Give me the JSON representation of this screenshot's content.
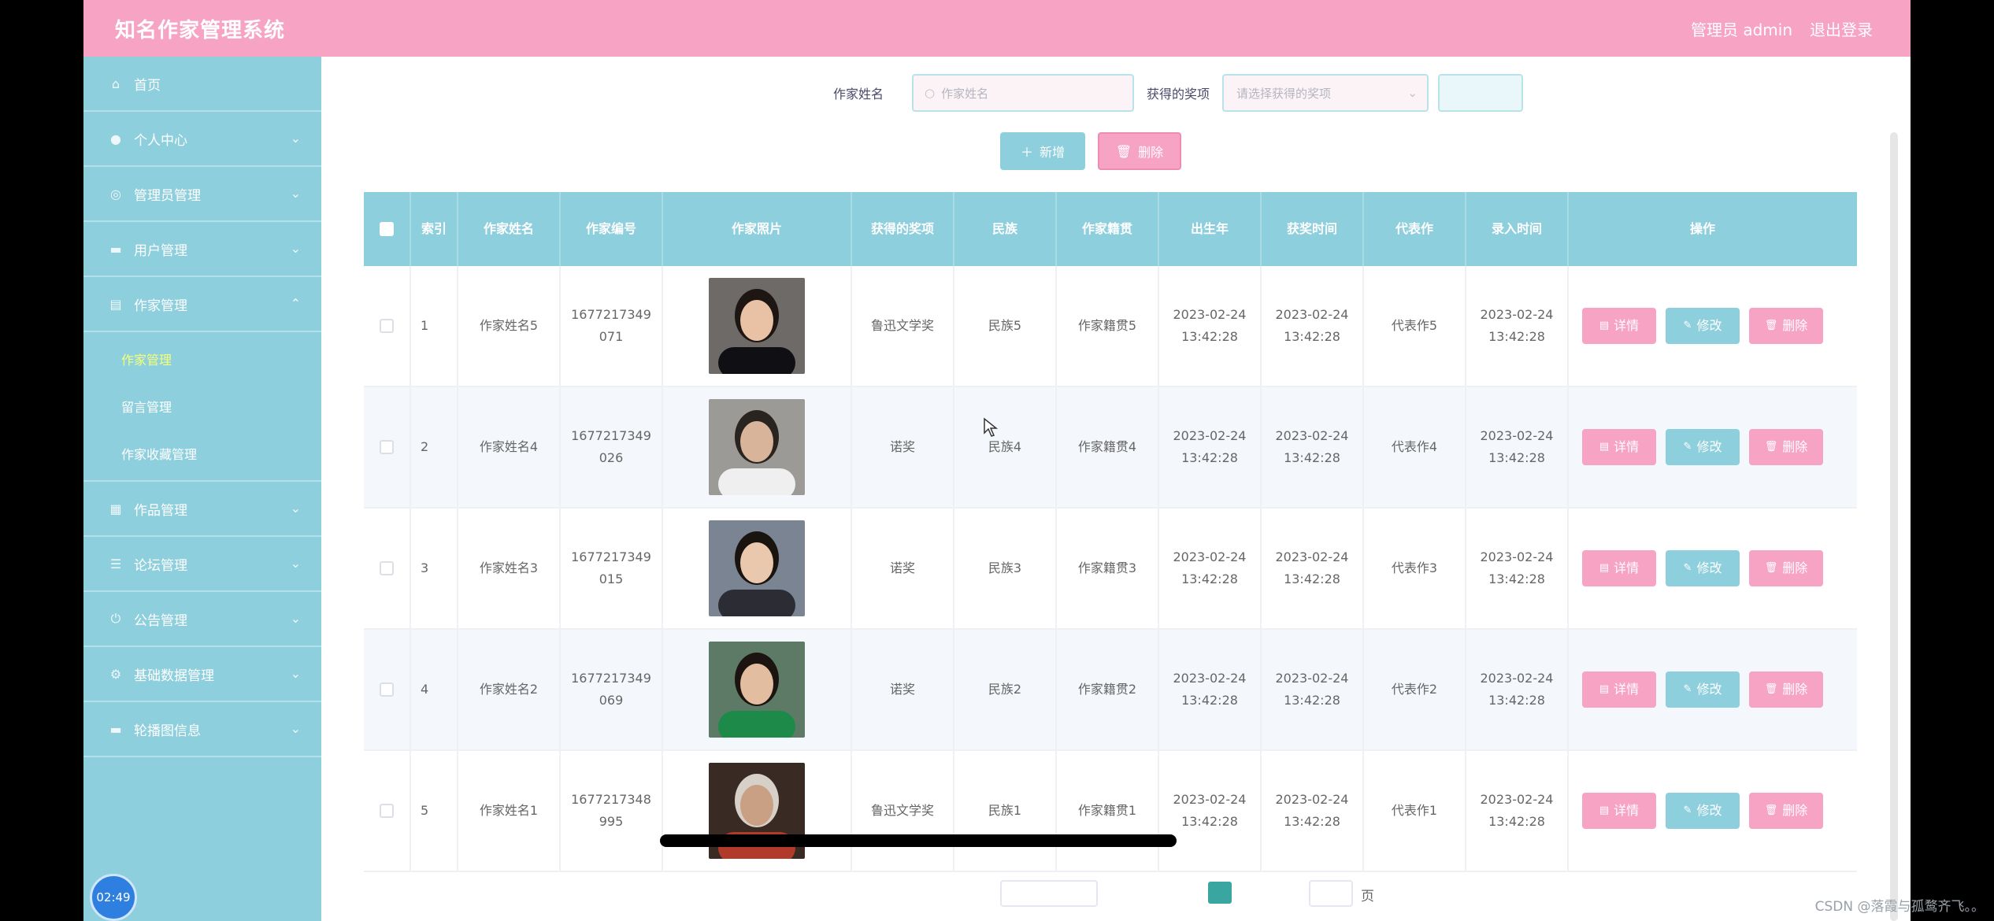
{
  "header": {
    "title": "知名作家管理系统",
    "user": "管理员 admin",
    "logout": "退出登录"
  },
  "sidebar": {
    "items": [
      {
        "label": "首页",
        "icon": "home-icon",
        "glyph": "⌂",
        "chevron": ""
      },
      {
        "label": "个人中心",
        "icon": "person-icon",
        "glyph": "●",
        "chevron": "⌄"
      },
      {
        "label": "管理员管理",
        "icon": "globe-icon",
        "glyph": "◎",
        "chevron": "⌄"
      },
      {
        "label": "用户管理",
        "icon": "ticket-icon",
        "glyph": "▬",
        "chevron": "⌄"
      },
      {
        "label": "作家管理",
        "icon": "folder-icon",
        "glyph": "▤",
        "chevron": "⌃"
      }
    ],
    "subitems": [
      {
        "label": "作家管理",
        "active": true
      },
      {
        "label": "留言管理",
        "active": false
      },
      {
        "label": "作家收藏管理",
        "active": false
      }
    ],
    "items_after": [
      {
        "label": "作品管理",
        "icon": "grid-icon",
        "glyph": "▦",
        "chevron": "⌄"
      },
      {
        "label": "论坛管理",
        "icon": "list-icon",
        "glyph": "☰",
        "chevron": "⌄"
      },
      {
        "label": "公告管理",
        "icon": "power-icon",
        "glyph": "⏻",
        "chevron": "⌄"
      },
      {
        "label": "基础数据管理",
        "icon": "gear-icon",
        "glyph": "⚙",
        "chevron": "⌄"
      },
      {
        "label": "轮播图信息",
        "icon": "image-icon",
        "glyph": "▬",
        "chevron": "⌄"
      }
    ],
    "clock": "02:49"
  },
  "search": {
    "name_label": "作家姓名",
    "name_placeholder": "作家姓名",
    "award_label": "获得的奖项",
    "award_placeholder": "请选择获得的奖项"
  },
  "actions": {
    "add": "新增",
    "delete": "删除"
  },
  "table": {
    "headers": [
      "索引",
      "作家姓名",
      "作家编号",
      "作家照片",
      "获得的奖项",
      "民族",
      "作家籍贯",
      "出生年",
      "获奖时间",
      "代表作",
      "录入时间",
      "操作"
    ],
    "rows": [
      {
        "index": "1",
        "name": "作家姓名5",
        "code1": "1677217349",
        "code2": "071",
        "award": "鲁迅文学奖",
        "ethnic": "民族5",
        "origin": "作家籍贯5",
        "birth_d": "2023-02-24",
        "birth_t": "13:42:28",
        "award_d": "2023-02-24",
        "award_t": "13:42:28",
        "work": "代表作5",
        "entry_d": "2023-02-24",
        "entry_t": "13:42:28"
      },
      {
        "index": "2",
        "name": "作家姓名4",
        "code1": "1677217349",
        "code2": "026",
        "award": "诺奖",
        "ethnic": "民族4",
        "origin": "作家籍贯4",
        "birth_d": "2023-02-24",
        "birth_t": "13:42:28",
        "award_d": "2023-02-24",
        "award_t": "13:42:28",
        "work": "代表作4",
        "entry_d": "2023-02-24",
        "entry_t": "13:42:28"
      },
      {
        "index": "3",
        "name": "作家姓名3",
        "code1": "1677217349",
        "code2": "015",
        "award": "诺奖",
        "ethnic": "民族3",
        "origin": "作家籍贯3",
        "birth_d": "2023-02-24",
        "birth_t": "13:42:28",
        "award_d": "2023-02-24",
        "award_t": "13:42:28",
        "work": "代表作3",
        "entry_d": "2023-02-24",
        "entry_t": "13:42:28"
      },
      {
        "index": "4",
        "name": "作家姓名2",
        "code1": "1677217349",
        "code2": "069",
        "award": "诺奖",
        "ethnic": "民族2",
        "origin": "作家籍贯2",
        "birth_d": "2023-02-24",
        "birth_t": "13:42:28",
        "award_d": "2023-02-24",
        "award_t": "13:42:28",
        "work": "代表作2",
        "entry_d": "2023-02-24",
        "entry_t": "13:42:28"
      },
      {
        "index": "5",
        "name": "作家姓名1",
        "code1": "1677217348",
        "code2": "995",
        "award": "鲁迅文学奖",
        "ethnic": "民族1",
        "origin": "作家籍贯1",
        "birth_d": "2023-02-24",
        "birth_t": "13:42:28",
        "award_d": "2023-02-24",
        "award_t": "13:42:28",
        "work": "代表作1",
        "entry_d": "2023-02-24",
        "entry_t": "13:42:28"
      }
    ],
    "row_actions": {
      "detail": "详情",
      "edit": "修改",
      "delete": "删除"
    }
  },
  "pager": {
    "page_suffix": "页"
  },
  "watermark": "CSDN @落霞与孤鹜齐飞。。",
  "colors": {
    "header_pink": "#f6a3c4",
    "sidebar_blue": "#8ecfdd",
    "active_sub": "#f5ff7a"
  }
}
